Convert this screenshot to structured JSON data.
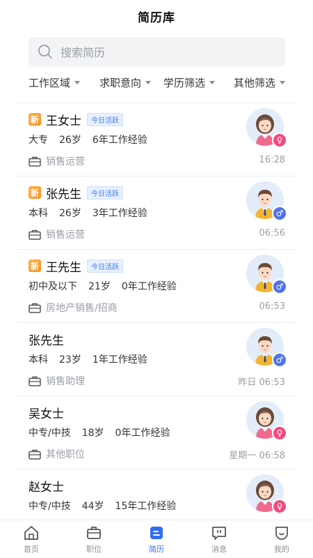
{
  "header": {
    "title": "简历库"
  },
  "search": {
    "placeholder": "搜索简历",
    "icon": "search-icon"
  },
  "filters": [
    {
      "label": "工作区域"
    },
    {
      "label": "求职意向"
    },
    {
      "label": "学历筛选"
    },
    {
      "label": "其他筛选"
    }
  ],
  "badges": {
    "new": "新",
    "active": "今日活跃"
  },
  "resumes": [
    {
      "name": "王女士",
      "is_new": true,
      "active_today": true,
      "education": "大专",
      "age": "26岁",
      "experience": "6年工作经验",
      "job": "销售运营",
      "time": "16:28",
      "gender": "female"
    },
    {
      "name": "张先生",
      "is_new": true,
      "active_today": true,
      "education": "本科",
      "age": "26岁",
      "experience": "3年工作经验",
      "job": "销售运营",
      "time": "06:56",
      "gender": "male"
    },
    {
      "name": "王先生",
      "is_new": true,
      "active_today": true,
      "education": "初中及以下",
      "age": "21岁",
      "experience": "0年工作经验",
      "job": "房地产销售/招商",
      "time": "06:53",
      "gender": "male"
    },
    {
      "name": "张先生",
      "is_new": false,
      "active_today": false,
      "education": "本科",
      "age": "23岁",
      "experience": "1年工作经验",
      "job": "销售助理",
      "time": "昨日 06:53",
      "gender": "male"
    },
    {
      "name": "吴女士",
      "is_new": false,
      "active_today": false,
      "education": "中专/中技",
      "age": "18岁",
      "experience": "0年工作经验",
      "job": "其他职位",
      "time": "星期一 06:58",
      "gender": "female"
    },
    {
      "name": "赵女士",
      "is_new": false,
      "active_today": false,
      "education": "中专/中技",
      "age": "44岁",
      "experience": "15年工作经验",
      "job": "",
      "time": "",
      "gender": "female"
    }
  ],
  "tabbar": [
    {
      "label": "首页",
      "icon": "home-icon",
      "active": false
    },
    {
      "label": "职位",
      "icon": "briefcase-icon",
      "active": false
    },
    {
      "label": "简历",
      "icon": "resume-icon",
      "active": true
    },
    {
      "label": "消息",
      "icon": "message-icon",
      "active": false
    },
    {
      "label": "我的",
      "icon": "profile-icon",
      "active": false
    }
  ],
  "colors": {
    "accent": "#2f6df5",
    "female": "#f04b7e",
    "male": "#5073e6",
    "new_badge": "#f7901e"
  }
}
